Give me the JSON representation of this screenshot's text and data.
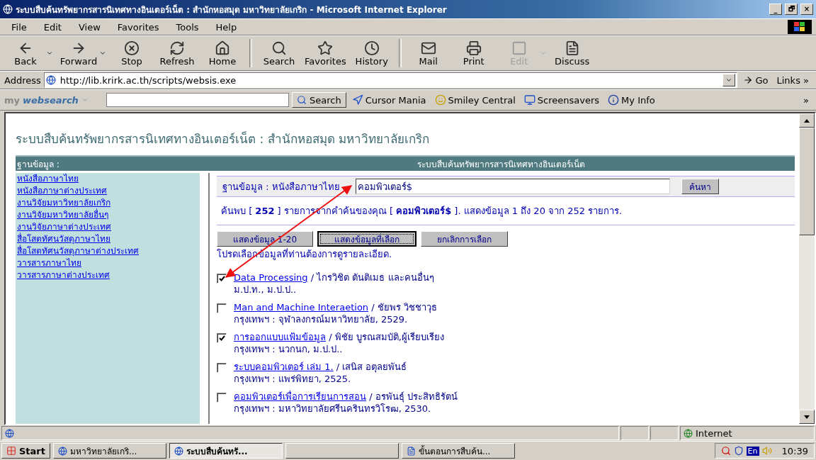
{
  "window": {
    "title": "ระบบสืบค้นทรัพยากรสารนิเทศทางอินเตอร์เน็ต : สำนักหอสมุด มหาวิทยาลัยเกริก - Microsoft Internet Explorer",
    "controls": [
      "_",
      "🗗",
      "×"
    ]
  },
  "menu": [
    "File",
    "Edit",
    "View",
    "Favorites",
    "Tools",
    "Help"
  ],
  "toolbar": [
    {
      "kind": "back",
      "label": "Back",
      "disabled": false,
      "dropdown": true
    },
    {
      "kind": "forward",
      "label": "Forward",
      "disabled": false,
      "dropdown": true
    },
    {
      "kind": "stop",
      "label": "Stop",
      "disabled": false,
      "dropdown": false
    },
    {
      "kind": "refresh",
      "label": "Refresh",
      "disabled": false,
      "dropdown": false
    },
    {
      "kind": "home",
      "label": "Home",
      "disabled": false,
      "dropdown": false
    },
    {
      "kind": "search",
      "label": "Search",
      "disabled": false,
      "dropdown": false
    },
    {
      "kind": "favorites",
      "label": "Favorites",
      "disabled": false,
      "dropdown": false
    },
    {
      "kind": "history",
      "label": "History",
      "disabled": false,
      "dropdown": false
    },
    {
      "kind": "mail",
      "label": "Mail",
      "disabled": false,
      "dropdown": false
    },
    {
      "kind": "print",
      "label": "Print",
      "disabled": false,
      "dropdown": false
    },
    {
      "kind": "edit",
      "label": "Edit",
      "disabled": true,
      "dropdown": true
    },
    {
      "kind": "discuss",
      "label": "Discuss",
      "disabled": false,
      "dropdown": false
    }
  ],
  "address": {
    "label": "Address",
    "value": "http://lib.krirk.ac.th/scripts/websis.exe",
    "go": "Go",
    "links": "Links »"
  },
  "search_bar": {
    "brand_plain": "my",
    "brand_bold": "websearch",
    "search": "Search",
    "links": [
      {
        "kind": "cursor",
        "label": "Cursor Mania"
      },
      {
        "kind": "smiley",
        "label": "Smiley Central"
      },
      {
        "kind": "screen",
        "label": "Screensavers"
      },
      {
        "kind": "info",
        "label": "My Info"
      }
    ],
    "more": "»"
  },
  "page": {
    "heading": "ระบบสืบค้นทรัพยากรสารนิเทศทางอินเตอร์เน็ต : สำนักหอสมุด มหาวิทยาลัยเกริก",
    "header_left": "ฐานข้อมูล :",
    "header_right": "ระบบสืบค้นทรัพยากรสารนิเทศทางอินเตอร์เน็ต",
    "databases": [
      "หนังสือภาษาไทย",
      "หนังสือภาษาต่างประเทศ",
      "งานวิจัยมหาวิทยาลัยเกริก",
      "งานวิจัยมหาวิทยาลัยอื่นๆ",
      "งานวิจัยภาษาต่างประเทศ",
      "สื่อโสตทัศนวัสดุภาษาไทย",
      "สื่อโสตทัศนวัสดุภาษาต่างประเทศ",
      "วารสารภาษาไทย",
      "วารสารภาษาต่างประเทศ"
    ],
    "search_label": "ฐานข้อมูล : หนังสือภาษาไทย",
    "search_value": "คอมพิวเตอร์$",
    "search_button": "ค้นหา",
    "result_summary": "ค้นพบ [ **252** ] รายการจากคำค้นของคุณ [ **คอมพิวเตอร์$** ]. แสดงข้อมูล 1 ถึง 20 จาก 252 รายการ.",
    "buttons": [
      {
        "label": "แสดงข้อมูล 1-20",
        "focused": false
      },
      {
        "label": "แสดงข้อมูลที่เลือก",
        "focused": true
      },
      {
        "label": "ยกเลิกการเลือก",
        "focused": false
      }
    ],
    "instruction": "โปรดเลือกข้อมูลที่ท่านต้องการดูรายละเอียด.",
    "results": [
      {
        "title": "Data Processing",
        "author": "/ ไกรวิชิต ตันติเมธ และคนอื่นๆ",
        "imprint": "ม.ป.ท., ม.ป.ป..",
        "checked": true
      },
      {
        "title": "Man and Machine Interaetion",
        "author": "/ ชัยพร วิชชาวุธ",
        "imprint": "กรุงเทพฯ : จุฬาลงกรณ์มหาวิทยาลัย, 2529.",
        "checked": false
      },
      {
        "title": "การออกแบบแฟ้มข้อมูล",
        "author": "/ พิชัย บูรณสมบัติ,ผู้เรียบเรียง",
        "imprint": "กรุงเทพฯ : นวกนก, ม.ป.ป..",
        "checked": true
      },
      {
        "title": "ระบบคอมพิวเตอร์ เล่ม 1.",
        "author": "/ เสนิส อตุลยพันธ์",
        "imprint": "กรุงเทพฯ : แพร่พิทยา, 2525.",
        "checked": false
      },
      {
        "title": "คอมพิวเตอร์เพื่อการเรียนการสอน",
        "author": "/ อรพันธุ์ ประสิทธิรัตน์",
        "imprint": "กรุงเทพฯ : มหาวิทยาลัยศรีนครินทรวิโรฒ, 2530.",
        "checked": false
      }
    ]
  },
  "status_bar": {
    "zone": "Internet"
  },
  "taskbar": {
    "start": "Start",
    "items": [
      {
        "kind": "ie",
        "label": "มหาวิทยาลัยเกริ...",
        "selected": false
      },
      {
        "kind": "ie",
        "label": "ระบบสืบค้นทรั...",
        "selected": true
      },
      {
        "kind": "blank",
        "selected": false
      },
      {
        "kind": "word",
        "label": "ขั้นตอนการสืบค้น...",
        "selected": false
      }
    ],
    "lang": "En",
    "time": "10:39"
  }
}
